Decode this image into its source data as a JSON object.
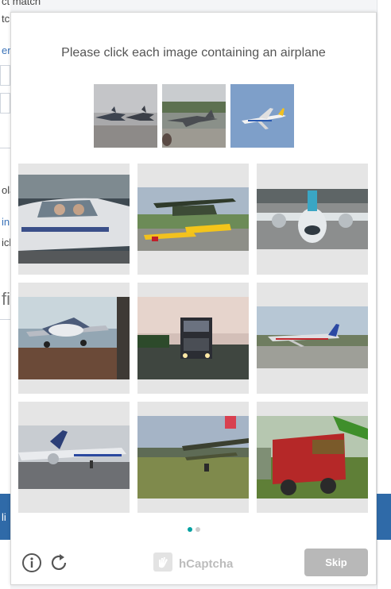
{
  "background": {
    "fragments": [
      "ct match",
      "tch",
      "er",
      "ola",
      "in",
      "icl",
      "fic"
    ],
    "footer_text": "li"
  },
  "challenge": {
    "prompt": "Please click each image containing an airplane",
    "examples": [
      {
        "subject": "jet-fighters-on-runway"
      },
      {
        "subject": "military-jet-parked"
      },
      {
        "subject": "airliner-in-sky"
      }
    ],
    "tiles": [
      {
        "subject": "small-plane-cockpit-closeup"
      },
      {
        "subject": "propeller-airplanes-airshow"
      },
      {
        "subject": "airliner-front-view"
      },
      {
        "subject": "small-propeller-plane-hangar"
      },
      {
        "subject": "truck-on-road-dusk"
      },
      {
        "subject": "airliner-taking-off"
      },
      {
        "subject": "airliner-on-tarmac"
      },
      {
        "subject": "biplane-on-grass"
      },
      {
        "subject": "farm-trailer-hay"
      }
    ],
    "pagination": {
      "current": 1,
      "total": 2
    },
    "footer": {
      "brand": "hCaptcha",
      "skip_label": "Skip",
      "info_icon": "info-icon",
      "refresh_icon": "refresh-icon",
      "logo_icon": "hcaptcha-hand-icon"
    }
  },
  "colors": {
    "accent": "#00a1a1",
    "skip_bg": "#b8b8b8",
    "footer_bg": "#2f6aa8"
  }
}
